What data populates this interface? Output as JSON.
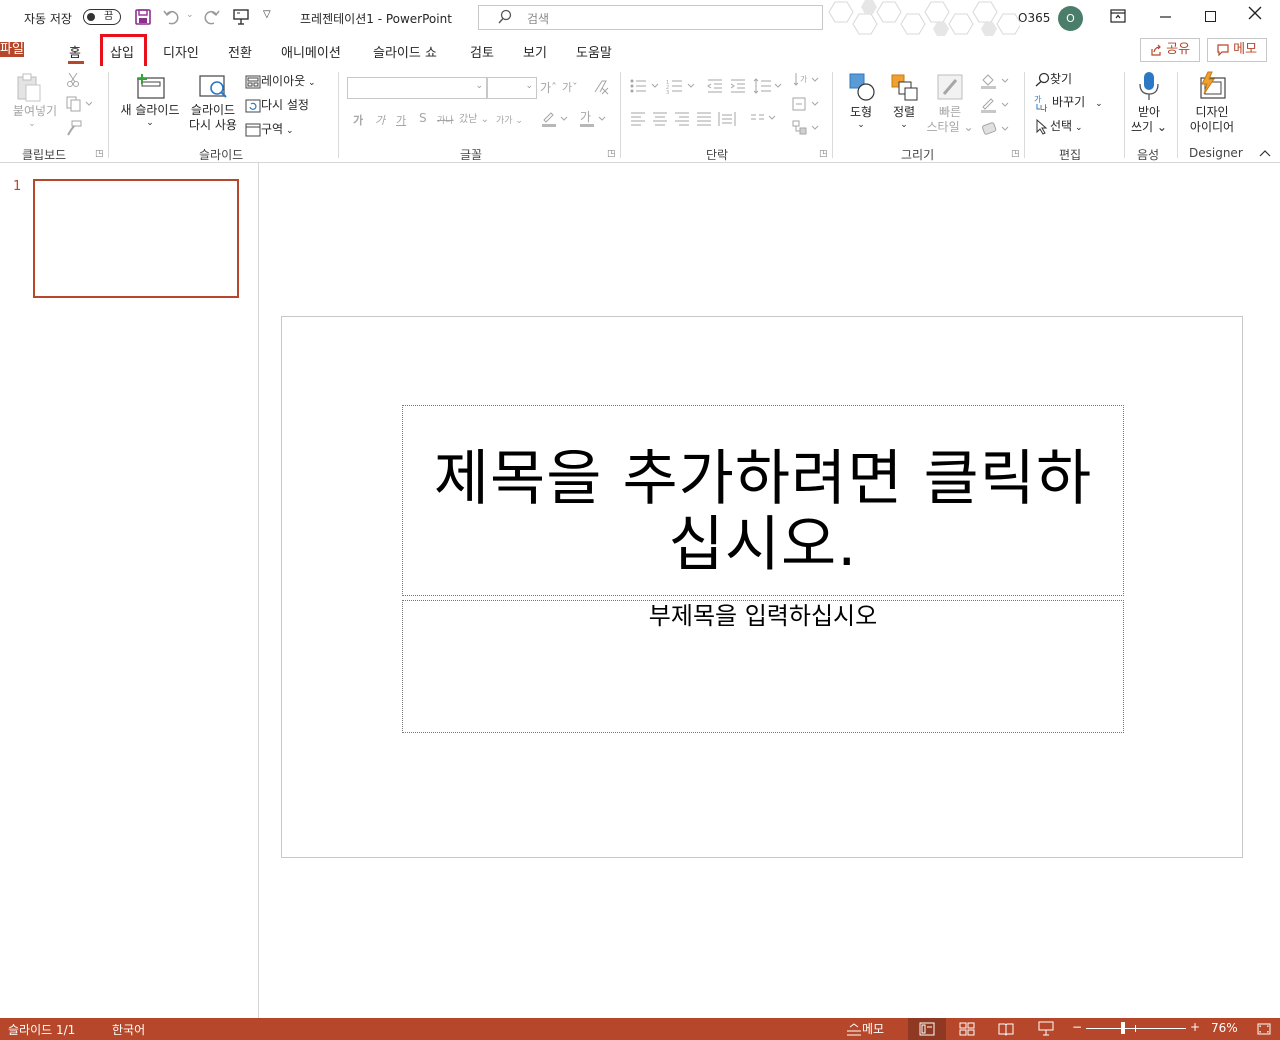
{
  "titlebar": {
    "autosave_label": "자동 저장",
    "autosave_state": "끔",
    "doc_title": "프레젠테이션1  -  PowerPoint",
    "search_placeholder": "검색",
    "account_name": "O365",
    "avatar_initial": "O"
  },
  "tabs": {
    "file": "파일",
    "home": "홈",
    "insert": "삽입",
    "design": "디자인",
    "transitions": "전환",
    "animations": "애니메이션",
    "slideshow": "슬라이드 쇼",
    "review": "검토",
    "view": "보기",
    "help": "도움말",
    "share": "공유",
    "memo": "메모"
  },
  "ribbon": {
    "clipboard": {
      "group": "클립보드",
      "paste": "붙여넣기"
    },
    "slides": {
      "group": "슬라이드",
      "new_slide": "새 슬라이드",
      "reuse_1": "슬라이드",
      "reuse_2": "다시 사용",
      "layout": "레이아웃",
      "reset": "다시 설정",
      "section": "구역"
    },
    "font": {
      "group": "글꼴"
    },
    "paragraph": {
      "group": "단락"
    },
    "drawing": {
      "group": "그리기",
      "shapes": "도형",
      "arrange": "정렬",
      "quick_styles_1": "빠른",
      "quick_styles_2": "스타일"
    },
    "editing": {
      "group": "편집",
      "find": "찾기",
      "replace": "바꾸기",
      "select": "선택"
    },
    "voice": {
      "group": "음성",
      "dictate_1": "받아",
      "dictate_2": "쓰기"
    },
    "designer": {
      "group": "Designer",
      "ideas_1": "디자인",
      "ideas_2": "아이디어"
    }
  },
  "thumbnails": {
    "slide_number": "1"
  },
  "slide": {
    "title_line1": "제목을 추가하려면 클릭하",
    "title_line2": "십시오.",
    "subtitle": "부제목을 입력하십시오"
  },
  "statusbar": {
    "slide_info": "슬라이드 1/1",
    "language": "한국어",
    "notes": "메모",
    "zoom_minus": "−",
    "zoom_plus": "+",
    "zoom_level": "76%"
  },
  "colors": {
    "accent": "#b7472a",
    "highlight": "#e8101b"
  }
}
